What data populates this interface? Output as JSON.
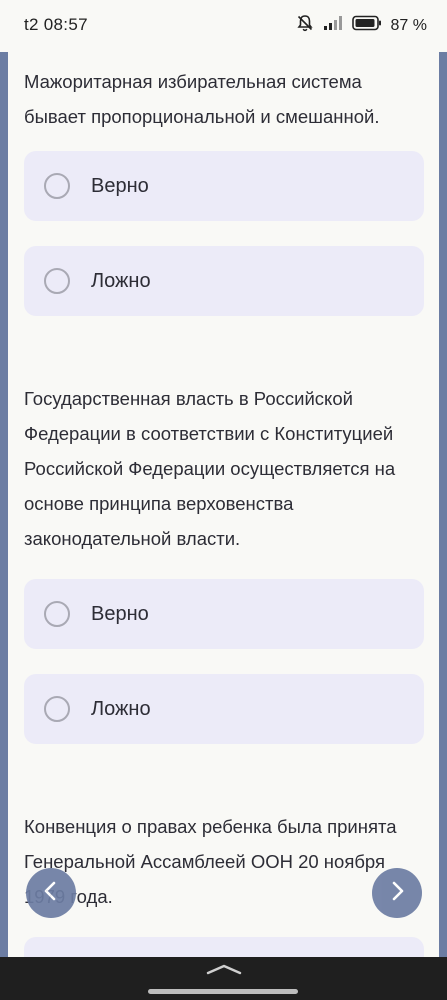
{
  "status_bar": {
    "time": "t2 08:57",
    "battery_percent": "87 %",
    "icons": [
      "bell-off-icon",
      "signal-icon",
      "battery-icon"
    ]
  },
  "questions": [
    {
      "text": "Мажоритарная избирательная система бывает пропорциональной и смешанной.",
      "options": [
        {
          "label": "Верно",
          "selected": false
        },
        {
          "label": "Ложно",
          "selected": false
        }
      ]
    },
    {
      "text": "Государственная власть в Российской Федерации в соответствии с Конституцией Российской Федерации осуществляется на основе принципа верховенства законодательной власти.",
      "options": [
        {
          "label": "Верно",
          "selected": false
        },
        {
          "label": "Ложно",
          "selected": false
        }
      ]
    },
    {
      "text": "Конвенция о правах ребенка была принята Генеральной Ассамблеей ООН 20 ноября 1979 года."
    }
  ],
  "nav": {
    "prev_icon": "chevron-left-icon",
    "next_icon": "chevron-right-icon"
  },
  "colors": {
    "accent": "#6c7da3",
    "option_bg": "#ecebf8",
    "page_bg": "#f9f9f6"
  }
}
